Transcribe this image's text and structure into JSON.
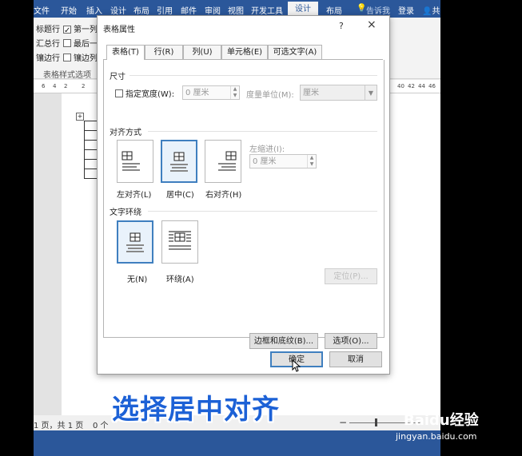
{
  "ribbon": {
    "tabs": [
      "文件",
      "开始",
      "插入",
      "设计",
      "布局",
      "引用",
      "邮件",
      "审阅",
      "视图",
      "开发工具",
      "设计",
      "布局"
    ],
    "tell_me": "告诉我",
    "login": "登录",
    "share": "共",
    "options": [
      "标题行",
      "第一列",
      "汇总行",
      "最后一",
      "镶边行",
      "镶边列"
    ],
    "group_label": "表格样式选项"
  },
  "ruler": {
    "ticks": [
      "6",
      "4",
      "2",
      "",
      "2",
      "4",
      "6",
      "8"
    ],
    "right_ticks": [
      "40",
      "42",
      "44",
      "46"
    ]
  },
  "status": {
    "pages": "1 页，共 1 页",
    "words": "0 个"
  },
  "dialog": {
    "title": "表格属性",
    "help": "?",
    "close": "×",
    "tabs": [
      "表格(T)",
      "行(R)",
      "列(U)",
      "单元格(E)",
      "可选文字(A)"
    ],
    "size": {
      "section": "尺寸",
      "width_check": "指定宽度(W):",
      "width_value": "0 厘米",
      "unit_label": "度量单位(M):",
      "unit_value": "厘米"
    },
    "alignment": {
      "section": "对齐方式",
      "options": [
        "左对齐(L)",
        "居中(C)",
        "右对齐(H)"
      ],
      "selected": "居中(C)",
      "indent_label": "左缩进(I):",
      "indent_value": "0 厘米"
    },
    "wrapping": {
      "section": "文字环绕",
      "options": [
        "无(N)",
        "环绕(A)"
      ],
      "selected": "无(N)",
      "position_button": "定位(P)..."
    },
    "borders_button": "边框和底纹(B)...",
    "options_button": "选项(O)...",
    "ok": "确定",
    "cancel": "取消"
  },
  "caption": "选择居中对齐",
  "watermark": {
    "brand": "Baidu经验",
    "url": "jingyan.baidu.com"
  }
}
